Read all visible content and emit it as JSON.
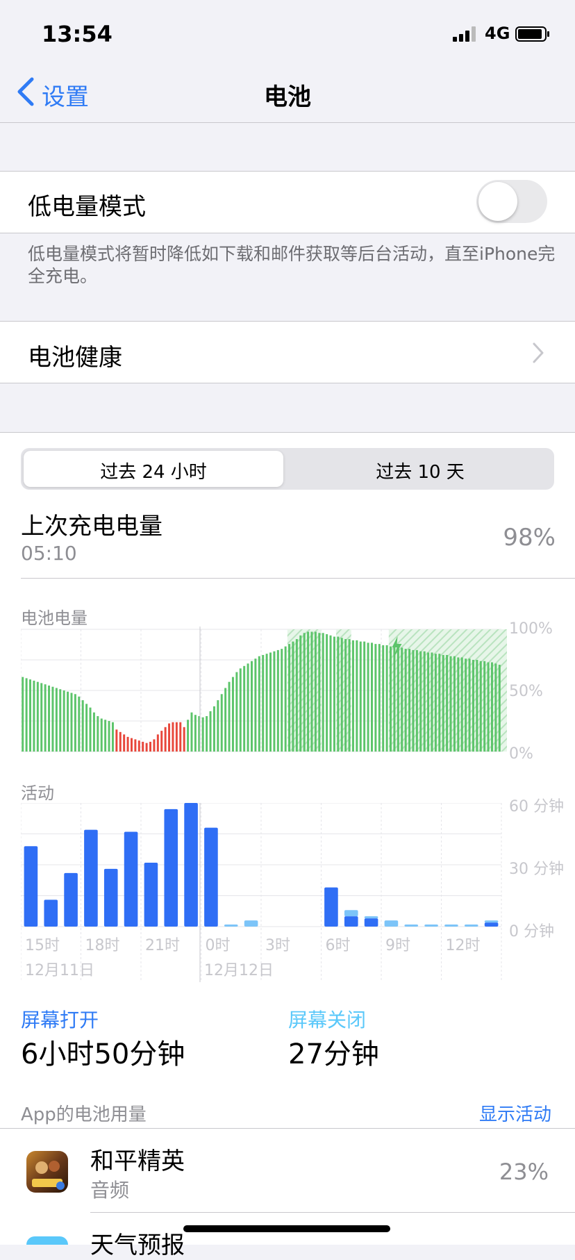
{
  "status_bar": {
    "time": "13:54",
    "network": "4G"
  },
  "nav": {
    "back_label": "设置",
    "title": "电池"
  },
  "low_power": {
    "label": "低电量模式",
    "on": false,
    "footnote": "低电量模式将暂时降低如下载和邮件获取等后台活动，直至iPhone完全充电。"
  },
  "battery_health": {
    "label": "电池健康"
  },
  "segmented": {
    "options": [
      "过去 24 小时",
      "过去 10 天"
    ],
    "selected": 0
  },
  "last_charge": {
    "title": "上次充电电量",
    "time": "05:10",
    "percent": "98%"
  },
  "battery_chart_title": "电池电量",
  "activity_chart_title": "活动",
  "chart_data": [
    {
      "type": "bar",
      "title": "电池电量",
      "y_ticks": [
        "100%",
        "50%",
        "0%"
      ],
      "ylim": [
        0,
        100
      ],
      "charging_ranges": [
        [
          71,
          80
        ],
        [
          84,
          88
        ],
        [
          98,
          143
        ]
      ],
      "values": [
        61,
        60,
        59,
        58,
        57,
        56,
        55,
        54,
        53,
        52,
        51,
        50,
        49,
        48,
        47,
        45,
        42,
        39,
        36,
        32,
        29,
        27,
        26,
        25,
        24,
        18,
        16,
        14,
        12,
        11,
        10,
        9,
        8,
        7,
        8,
        10,
        14,
        17,
        20,
        23,
        24,
        24,
        24,
        20,
        26,
        32,
        30,
        29,
        28,
        29,
        33,
        37,
        42,
        47,
        52,
        57,
        61,
        65,
        68,
        70,
        72,
        74,
        76,
        78,
        79,
        80,
        81,
        82,
        83,
        84,
        86,
        88,
        90,
        92,
        95,
        97,
        98,
        98,
        98,
        97,
        97,
        96,
        95,
        94,
        94,
        93,
        92,
        92,
        91,
        91,
        90,
        90,
        89,
        89,
        88,
        88,
        87,
        87,
        86,
        86,
        85,
        85,
        84,
        84,
        83,
        83,
        82,
        82,
        81,
        81,
        80,
        80,
        79,
        79,
        78,
        78,
        77,
        77,
        76,
        76,
        75,
        75,
        74,
        74,
        73,
        73,
        72,
        71
      ],
      "low_indices": [
        25,
        26,
        27,
        28,
        29,
        30,
        31,
        32,
        33,
        34,
        35,
        36,
        37,
        38,
        39,
        40,
        41,
        42,
        43
      ]
    },
    {
      "type": "bar",
      "title": "活动",
      "y_ticks": [
        "60 分钟",
        "30 分钟",
        "0 分钟"
      ],
      "ylim": [
        0,
        60
      ],
      "categories": [
        "15时",
        "",
        "18时",
        "",
        "21时",
        "",
        "0时",
        "",
        "3时",
        "",
        "6时",
        "",
        "9时",
        "",
        "12时",
        ""
      ],
      "x_ticks": [
        "15时",
        "18时",
        "21时",
        "0时",
        "3时",
        "6时",
        "9时",
        "12时"
      ],
      "date_labels": [
        "12月11日",
        "12月12日"
      ],
      "series": [
        {
          "name": "屏幕打开",
          "color": "#2f6ef5",
          "values": [
            39,
            13,
            26,
            47,
            28,
            46,
            31,
            57,
            60,
            48,
            0,
            0,
            0,
            0,
            0,
            19,
            5,
            4,
            0,
            0,
            0,
            0,
            0,
            2
          ]
        },
        {
          "name": "屏幕关闭",
          "color": "#7cc4f8",
          "values": [
            0,
            0,
            0,
            0,
            0,
            0,
            0,
            0,
            0,
            0,
            1,
            3,
            0,
            0,
            0,
            0,
            3,
            1,
            3,
            1,
            1,
            1,
            1,
            1
          ]
        }
      ]
    }
  ],
  "screen_on": {
    "label": "屏幕打开",
    "value": "6小时50分钟"
  },
  "screen_off": {
    "label": "屏幕关闭",
    "value": "27分钟"
  },
  "app_usage": {
    "header": "App的电池用量",
    "action": "显示活动"
  },
  "apps": [
    {
      "name": "和平精英",
      "subtitle": "音频",
      "percent": "23%",
      "icon": "game-app-icon"
    },
    {
      "name": "天气预报",
      "icon": "weather-app-icon"
    }
  ],
  "colors": {
    "accent": "#2f7bf5",
    "green": "#5cc46a",
    "red": "#e8473b",
    "screen_on": "#2f6ef5",
    "screen_off": "#7cc4f8"
  }
}
